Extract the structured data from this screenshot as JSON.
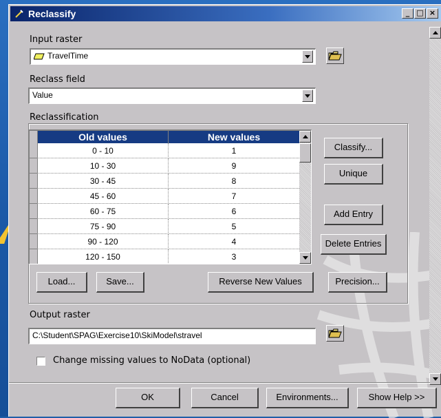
{
  "window": {
    "title": "Reclassify",
    "controls": {
      "minimize": "_",
      "maximize": "□",
      "close": "×"
    }
  },
  "input_raster": {
    "label": "Input raster",
    "value": "TravelTime"
  },
  "reclass_field": {
    "label": "Reclass field",
    "value": "Value"
  },
  "reclassification": {
    "label": "Reclassification",
    "columns": [
      "Old values",
      "New values"
    ],
    "rows": [
      {
        "old": "0 - 10",
        "new": "1"
      },
      {
        "old": "10 - 30",
        "new": "9"
      },
      {
        "old": "30 - 45",
        "new": "8"
      },
      {
        "old": "45 - 60",
        "new": "7"
      },
      {
        "old": "60 - 75",
        "new": "6"
      },
      {
        "old": "75 - 90",
        "new": "5"
      },
      {
        "old": "90 - 120",
        "new": "4"
      },
      {
        "old": "120 - 150",
        "new": "3"
      }
    ],
    "buttons": {
      "classify": "Classify...",
      "unique": "Unique",
      "add_entry": "Add Entry",
      "delete_entries": "Delete Entries",
      "load": "Load...",
      "save": "Save...",
      "reverse": "Reverse New Values",
      "precision": "Precision..."
    }
  },
  "output_raster": {
    "label": "Output raster",
    "value": "C:\\Student\\SPAG\\Exercise10\\SkiModel\\stravel"
  },
  "missing_values": {
    "label": "Change missing values to NoData (optional)",
    "checked": false
  },
  "footer": {
    "ok": "OK",
    "cancel": "Cancel",
    "environments": "Environments...",
    "show_help": "Show Help >>"
  },
  "colors": {
    "background": "#1f5ea8",
    "dialog": "#c6c3c6",
    "title_bar": "#0a246a",
    "table_header": "#163b83"
  },
  "icons": [
    "reclassify-tool-icon",
    "raster-layer-icon",
    "open-folder-icon"
  ]
}
